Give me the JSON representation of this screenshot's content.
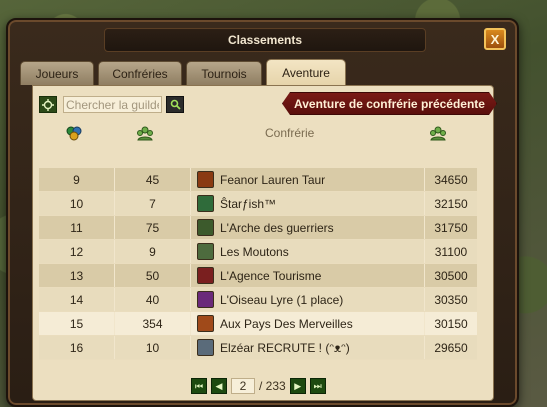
{
  "window": {
    "title": "Classements",
    "close_label": "X"
  },
  "tabs": [
    {
      "label": "Joueurs",
      "active": false
    },
    {
      "label": "Confréries",
      "active": false
    },
    {
      "label": "Tournois",
      "active": false
    },
    {
      "label": "Aventure",
      "active": true
    }
  ],
  "search": {
    "placeholder": "Chercher la guilde",
    "value": ""
  },
  "previous_adventure_button": "Aventure de confrérie précédente",
  "table": {
    "headers": {
      "guild": "Confrérie"
    },
    "rows": [
      {
        "rank": "9",
        "count": "45",
        "name": "Feanor Lauren Taur",
        "score": "34650",
        "badge_color": "#8a3a12",
        "highlight": false
      },
      {
        "rank": "10",
        "count": "7",
        "name": "Ŝtarƒish™",
        "score": "32150",
        "badge_color": "#2f6b3a",
        "highlight": false
      },
      {
        "rank": "11",
        "count": "75",
        "name": "L'Arche des guerriers",
        "score": "31750",
        "badge_color": "#3c5a2c",
        "highlight": false
      },
      {
        "rank": "12",
        "count": "9",
        "name": "Les Moutons",
        "score": "31100",
        "badge_color": "#4d6b3e",
        "highlight": false
      },
      {
        "rank": "13",
        "count": "50",
        "name": "L'Agence Tourisme",
        "score": "30500",
        "badge_color": "#7a1f1f",
        "highlight": false
      },
      {
        "rank": "14",
        "count": "40",
        "name": "L'Oiseau Lyre (1 place)",
        "score": "30350",
        "badge_color": "#6a2a7a",
        "highlight": false
      },
      {
        "rank": "15",
        "count": "354",
        "name": "Aux Pays Des Merveilles",
        "score": "30150",
        "badge_color": "#a04a1a",
        "highlight": true
      },
      {
        "rank": "16",
        "count": "10",
        "name": "Elzéar RECRUTE ! (ᵔᴥᵔ)",
        "score": "29650",
        "badge_color": "#5a6b7a",
        "highlight": false
      }
    ]
  },
  "pagination": {
    "current_page": "2",
    "total_label": "/ 233"
  }
}
